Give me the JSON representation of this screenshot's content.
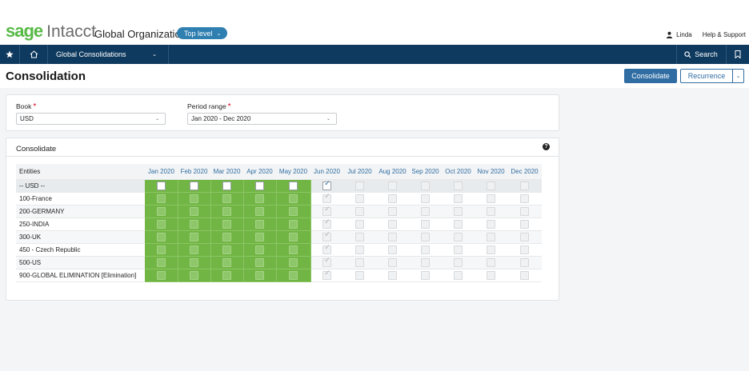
{
  "header": {
    "brand_sage": "sage",
    "brand_intacct": "Intacct",
    "org_name": "Global Organization",
    "level_pill": "Top level",
    "user": "Linda",
    "help": "Help & Support"
  },
  "nav": {
    "module": "Global Consolidations",
    "search": "Search"
  },
  "page": {
    "title": "Consolidation",
    "consolidate_button": "Consolidate",
    "recurrence_button": "Recurrence"
  },
  "filters": {
    "book_label": "Book",
    "book_value": "USD",
    "period_label": "Period range",
    "period_value": "Jan 2020 - Dec 2020",
    "required_mark": "*"
  },
  "consolidate": {
    "title": "Consolidate",
    "entities_header": "Entities",
    "months": [
      "Jan 2020",
      "Feb 2020",
      "Mar 2020",
      "Apr 2020",
      "May 2020",
      "Jun 2020",
      "Jul 2020",
      "Aug 2020",
      "Sep 2020",
      "Oct 2020",
      "Nov 2020",
      "Dec 2020"
    ],
    "entities": [
      "-- USD --",
      "100-France",
      "200-GERMANY",
      "250-INDIA",
      "300-UK",
      "450 - Czech Republic",
      "500-US",
      "900-GLOBAL ELIMINATION [Elimination]"
    ],
    "consolidated_months_count": 5,
    "checked_month_index": 5
  },
  "colors": {
    "brand_green": "#58b947",
    "nav_bg": "#0f3a5f",
    "accent_blue": "#2f6da3",
    "consolidated_green": "#71b544"
  }
}
